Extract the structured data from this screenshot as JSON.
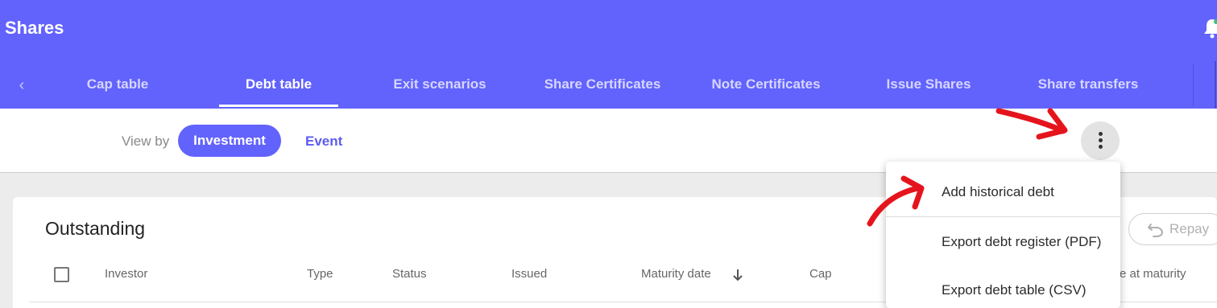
{
  "app": {
    "title": "Shares"
  },
  "tabs": [
    {
      "label": "Cap table",
      "active": false
    },
    {
      "label": "Debt table",
      "active": true
    },
    {
      "label": "Exit scenarios",
      "active": false
    },
    {
      "label": "Share Certificates",
      "active": false
    },
    {
      "label": "Note Certificates",
      "active": false
    },
    {
      "label": "Issue Shares",
      "active": false
    },
    {
      "label": "Share transfers",
      "active": false
    }
  ],
  "view_by": {
    "label": "View by",
    "options": [
      {
        "label": "Investment",
        "selected": true
      },
      {
        "label": "Event",
        "selected": false
      }
    ]
  },
  "more_menu": {
    "icon": "more-vertical-icon",
    "items": [
      {
        "label": "Add historical debt"
      },
      {
        "label": "Export debt register (PDF)"
      },
      {
        "label": "Export debt table (CSV)"
      }
    ]
  },
  "outstanding": {
    "title": "Outstanding",
    "repay_label": "Repay",
    "columns": [
      "Investor",
      "Type",
      "Status",
      "Issued",
      "Maturity date",
      "Cap",
      "e at maturity"
    ],
    "sort_column": "Maturity date",
    "sort_direction": "descending"
  },
  "colors": {
    "brand": "#6262fd",
    "annotation": "#e5141c"
  }
}
